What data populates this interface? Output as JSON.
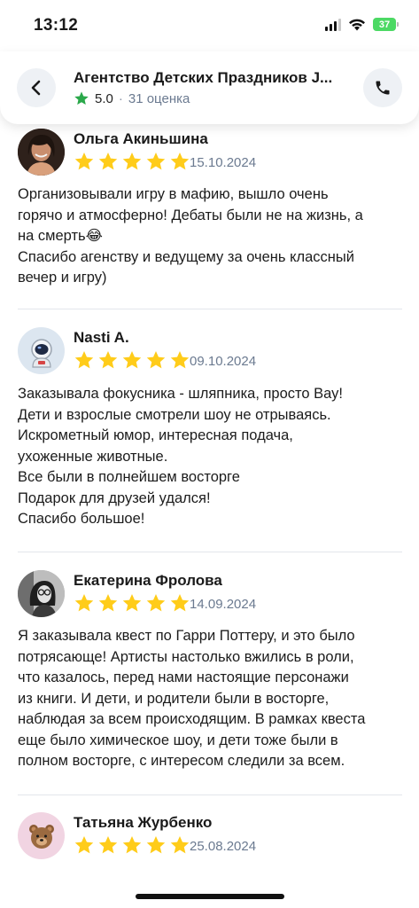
{
  "status": {
    "time": "13:12",
    "battery": "37"
  },
  "header": {
    "title": "Агентство Детских Праздников J...",
    "rating": "5.0",
    "separator": "·",
    "rating_count": "31 оценка",
    "star_color": "#2aa84a"
  },
  "star_color": "#ffcc1a",
  "reviews": [
    {
      "author": "Ольга Акиньшина",
      "date": "15.10.2024",
      "stars": 5,
      "avatar": "photo-woman-icon",
      "lines": [
        "Организовывали игру в мафию, вышло очень",
        "горячо и атмосферно! Дебаты были не на жизнь, а",
        "на смерть😂",
        "Спасибо агенству и ведущему за очень классный",
        "вечер и игру)"
      ]
    },
    {
      "author": "Nasti A.",
      "date": "09.10.2024",
      "stars": 5,
      "avatar": "astronaut-icon",
      "lines": [
        "Заказывала фокусника - шляпника, просто Вау!",
        "Дети и взрослые смотрели шоу не отрываясь.",
        "Искрометный юмор, интересная подача,",
        "ухоженные животные.",
        "Все были в полнейшем восторге",
        "Подарок для друзей удался!",
        "Спасибо большое!"
      ]
    },
    {
      "author": "Екатерина Фролова",
      "date": "14.09.2024",
      "stars": 5,
      "avatar": "photo-bw-woman-icon",
      "lines": [
        "Я заказывала квест по Гарри Поттеру, и это было",
        "потрясающе! Артисты настолько вжились в роли,",
        "что казалось, перед нами настоящие персонажи",
        "из книги. И дети, и родители были в восторге,",
        "наблюдая за всем происходящим. В рамках квеста",
        "еще было химическое шоу, и дети тоже были в",
        "полном восторге, с интересом следили за всем."
      ]
    },
    {
      "author": "Татьяна Журбенко",
      "date": "25.08.2024",
      "stars": 5,
      "avatar": "bear-icon",
      "lines": []
    }
  ]
}
